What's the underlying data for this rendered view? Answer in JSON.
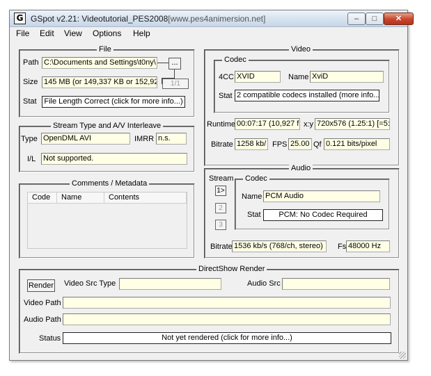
{
  "window": {
    "title_main": "GSpot v2.21: Videotutorial_PES2008",
    "title_url": "[www.pes4animersion.net]",
    "icon_glyph": "G",
    "min_glyph": "–",
    "max_glyph": "□",
    "close_glyph": "✕"
  },
  "menu": [
    "File",
    "Edit",
    "View",
    "Options",
    "Help"
  ],
  "file": {
    "title": "File",
    "path_label": "Path",
    "path_value": "C:\\Documents and Settings\\t0ny\\",
    "browse_label": "...",
    "size_label": "Size",
    "size_value": "145 MB (or 149,337 KB or 152,92",
    "page_indicator": "1/1",
    "stat_label": "Stat",
    "stat_value": "File Length Correct (click for more info...)"
  },
  "stream_type": {
    "title": "Stream Type and A/V Interleave",
    "type_label": "Type",
    "type_value": "OpenDML AVI",
    "imrr_label": "IMRR",
    "imrr_value": "n.s.",
    "il_label": "I/L",
    "il_value": "Not supported."
  },
  "comments": {
    "title": "Comments / Metadata",
    "columns": [
      "Code",
      "Name",
      "Contents"
    ]
  },
  "video": {
    "title": "Video",
    "codec_title": "Codec",
    "cc_label": "4CC",
    "cc_value": "XVID",
    "name_label": "Name",
    "name_value": "XviD",
    "stat_label": "Stat",
    "stat_value": "2 compatible codecs installed (more info...)",
    "runtime_label": "Runtime",
    "runtime_value": "00:07:17 (10,927 fr",
    "xy_label": "x:y",
    "xy_value": "720x576 (1.25:1) [=5:",
    "bitrate_label": "Bitrate",
    "bitrate_value": "1258 kb/",
    "fps_label": "FPS",
    "fps_value": "25.00",
    "qf_label": "Qf",
    "qf_value": "0.121 bits/pixel"
  },
  "audio": {
    "title": "Audio",
    "stream_label": "Stream",
    "stream_buttons": [
      "1>",
      "2",
      "3"
    ],
    "codec_title": "Codec",
    "name_label": "Name",
    "name_value": "PCM Audio",
    "stat_label": "Stat",
    "stat_value": "PCM: No Codec Required",
    "bitrate_label": "Bitrate",
    "bitrate_value": "1536 kb/s (768/ch, stereo)",
    "fs_label": "Fs",
    "fs_value": "48000 Hz"
  },
  "directshow": {
    "title": "DirectShow Render",
    "render_label": "Render",
    "video_src_type_label": "Video Src Type",
    "video_src_type_value": "",
    "audio_src_label": "Audio Src",
    "audio_src_value": "",
    "video_path_label": "Video Path",
    "video_path_value": "",
    "audio_path_label": "Audio Path",
    "audio_path_value": "",
    "status_label": "Status",
    "status_value": "Not yet rendered (click for more info...)"
  }
}
